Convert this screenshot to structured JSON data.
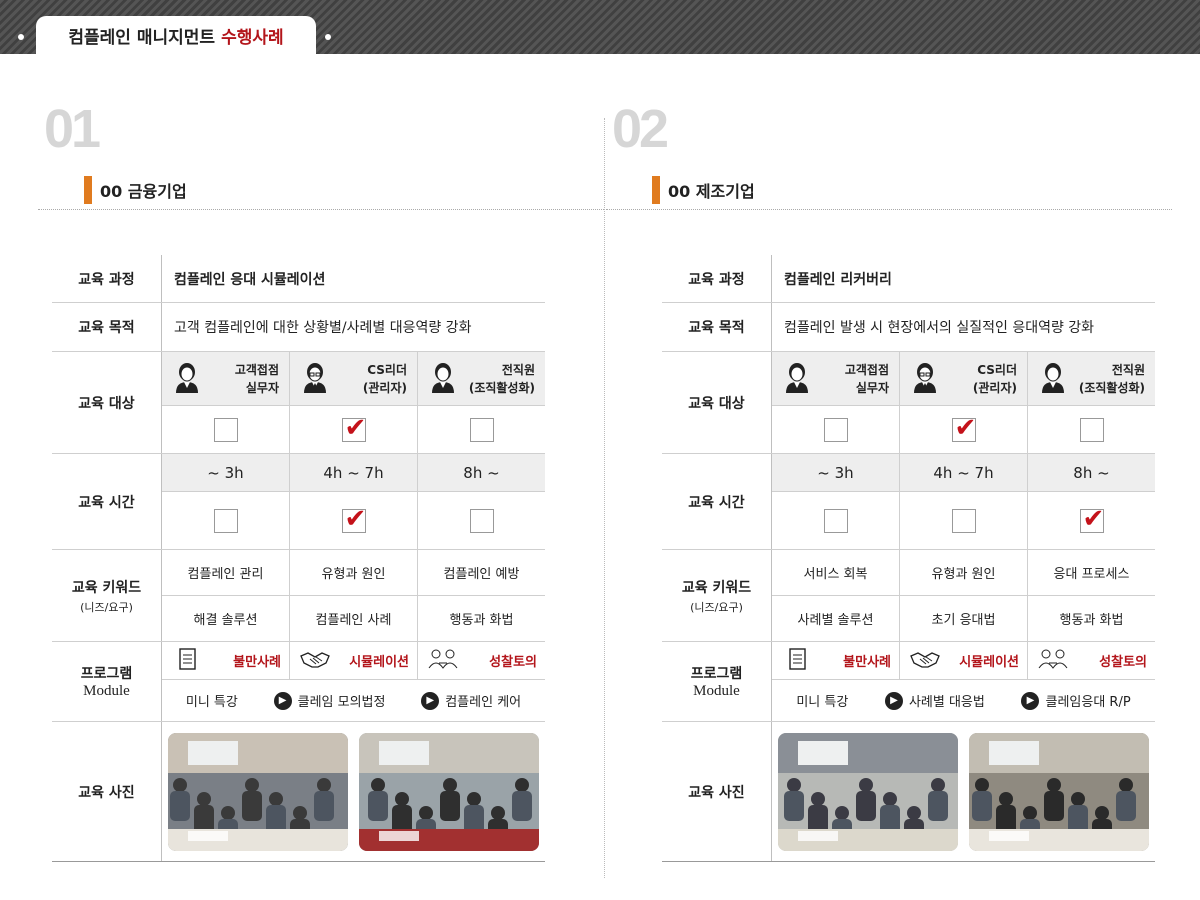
{
  "header": {
    "title_main": "컴플레인 매니지먼트",
    "title_accent": "수행사례"
  },
  "panels": [
    {
      "number": "01",
      "company": "00 금융기업",
      "course_label": "교육 과정",
      "course_value": "컴플레인 응대 시뮬레이션",
      "goal_label": "교육 목적",
      "goal_value": "고객 컴플레인에 대한 상황별/사례별 대응역량 강화",
      "target_label": "교육 대상",
      "targets": [
        {
          "line1": "고객접점",
          "line2": "실무자",
          "icon": "person-icon",
          "checked": false
        },
        {
          "line1": "CS리더",
          "line2": "(관리자)",
          "icon": "manager-icon",
          "checked": true
        },
        {
          "line1": "전직원",
          "line2": "(조직활성화)",
          "icon": "group-icon",
          "checked": false
        }
      ],
      "time_label": "교육 시간",
      "times": [
        {
          "text": "~ 3h",
          "checked": false
        },
        {
          "text": "4h ~ 7h",
          "checked": true
        },
        {
          "text": "8h ~",
          "checked": false
        }
      ],
      "keyword_label": "교육 키워드",
      "keyword_sub": "(니즈/요구)",
      "keywords": [
        "컴플레인 관리",
        "유형과 원인",
        "컴플레인 예방",
        "해결 솔루션",
        "컴플레인 사례",
        "행동과 화법"
      ],
      "program_label_1": "프로그램",
      "program_label_2": "Module",
      "modules": [
        {
          "label": "불만사례",
          "icon": "document-icon"
        },
        {
          "label": "시뮬레이션",
          "icon": "handshake-icon"
        },
        {
          "label": "성찰토의",
          "icon": "people-discussion-icon"
        }
      ],
      "flow": [
        "미니 특강",
        "클레임 모의법정",
        "컴플레인 케어"
      ],
      "photo_label": "교육 사진"
    },
    {
      "number": "02",
      "company": "00 제조기업",
      "course_label": "교육 과정",
      "course_value": "컴플레인 리커버리",
      "goal_label": "교육 목적",
      "goal_value": "컴플레인 발생 시 현장에서의 실질적인 응대역량 강화",
      "target_label": "교육 대상",
      "targets": [
        {
          "line1": "고객접점",
          "line2": "실무자",
          "icon": "person-icon",
          "checked": false
        },
        {
          "line1": "CS리더",
          "line2": "(관리자)",
          "icon": "manager-icon",
          "checked": true
        },
        {
          "line1": "전직원",
          "line2": "(조직활성화)",
          "icon": "group-icon",
          "checked": false
        }
      ],
      "time_label": "교육 시간",
      "times": [
        {
          "text": "~ 3h",
          "checked": false
        },
        {
          "text": "4h ~ 7h",
          "checked": false
        },
        {
          "text": "8h ~",
          "checked": true
        }
      ],
      "keyword_label": "교육 키워드",
      "keyword_sub": "(니즈/요구)",
      "keywords": [
        "서비스 회복",
        "유형과 원인",
        "응대 프로세스",
        "사례별 솔루션",
        "초기 응대법",
        "행동과 화법"
      ],
      "program_label_1": "프로그램",
      "program_label_2": "Module",
      "modules": [
        {
          "label": "불만사례",
          "icon": "document-icon"
        },
        {
          "label": "시뮬레이션",
          "icon": "handshake-icon"
        },
        {
          "label": "성찰토의",
          "icon": "people-discussion-icon"
        }
      ],
      "flow": [
        "미니 특강",
        "사례별 대응법",
        "클레임응대 R/P"
      ],
      "photo_label": "교육 사진"
    }
  ]
}
